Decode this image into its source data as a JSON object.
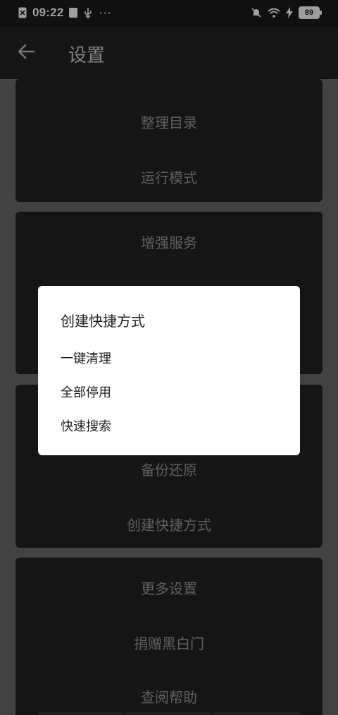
{
  "status_bar": {
    "time": "09:22",
    "more": "···",
    "battery": "89"
  },
  "app_bar": {
    "title": "设置"
  },
  "settings": {
    "card1": [
      "整理目录",
      "运行模式"
    ],
    "card2": [
      "增强服务"
    ],
    "card3": [
      "备份还原",
      "创建快捷方式"
    ],
    "card4": [
      "更多设置",
      "捐赠黑白门",
      "查阅帮助"
    ]
  },
  "dialog": {
    "title": "创建快捷方式",
    "items": [
      "一键清理",
      "全部停用",
      "快速搜索"
    ]
  }
}
